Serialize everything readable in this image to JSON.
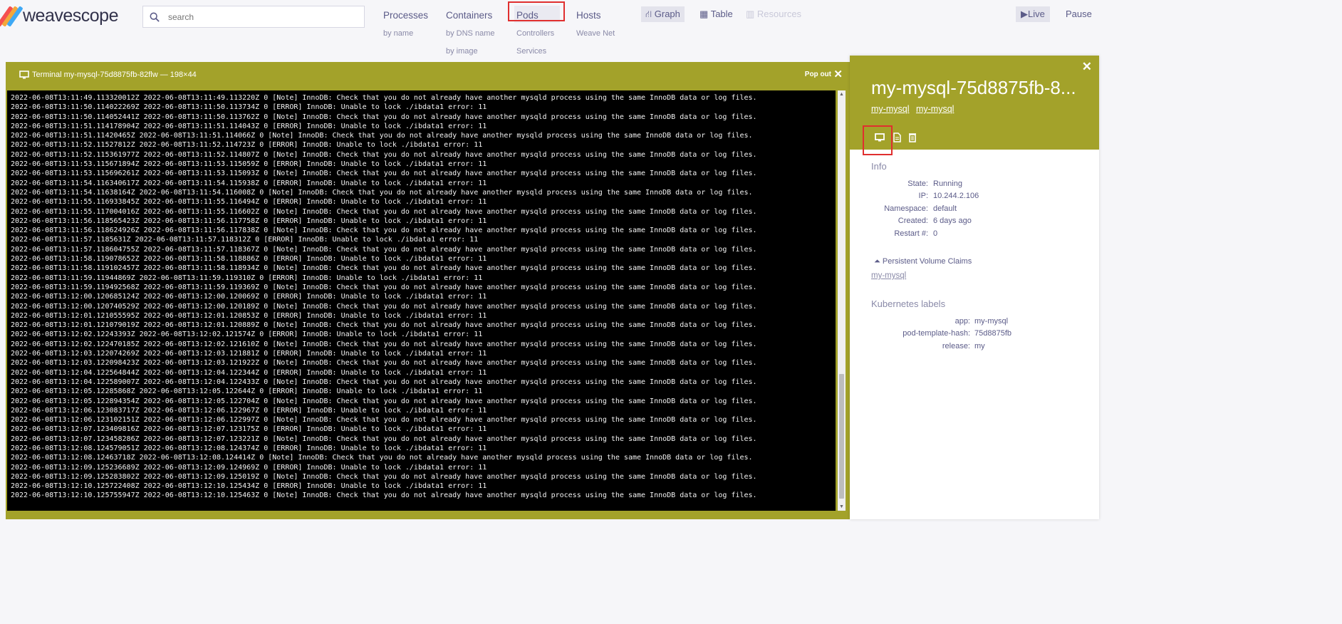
{
  "brand": {
    "weave": "weave",
    "scope": "scope",
    "colors": [
      "#f54f4f",
      "#f3a73b",
      "#7ab8e9",
      "#3fa9f5"
    ]
  },
  "search": {
    "placeholder": "search",
    "value": ""
  },
  "topologies": [
    {
      "label": "Processes",
      "subs": [
        "by name"
      ]
    },
    {
      "label": "Containers",
      "subs": [
        "by DNS name",
        "by image"
      ]
    },
    {
      "label": "Pods",
      "subs": [
        "Controllers",
        "Services"
      ]
    },
    {
      "label": "Hosts",
      "subs": [
        "Weave Net"
      ]
    }
  ],
  "views": {
    "graph": "Graph",
    "table": "Table",
    "resources": "Resources"
  },
  "controls": {
    "live": "Live",
    "pause": "Pause"
  },
  "terminal": {
    "title": "Terminal my-mysql-75d8875fb-82flw — 198×44",
    "popout": "Pop out",
    "close": "✕",
    "lines": [
      "2022-06-08T13:11:49.113320012Z 2022-06-08T13:11:49.113220Z 0 [Note] InnoDB: Check that you do not already have another mysqld process using the same InnoDB data or log files.",
      "2022-06-08T13:11:50.114022269Z 2022-06-08T13:11:50.113734Z 0 [ERROR] InnoDB: Unable to lock ./ibdata1 error: 11",
      "2022-06-08T13:11:50.114052441Z 2022-06-08T13:11:50.113762Z 0 [Note] InnoDB: Check that you do not already have another mysqld process using the same InnoDB data or log files.",
      "2022-06-08T13:11:51.114178904Z 2022-06-08T13:11:51.114043Z 0 [ERROR] InnoDB: Unable to lock ./ibdata1 error: 11",
      "2022-06-08T13:11:51.11420465Z 2022-06-08T13:11:51.114066Z 0 [Note] InnoDB: Check that you do not already have another mysqld process using the same InnoDB data or log files.",
      "2022-06-08T13:11:52.11527812Z 2022-06-08T13:11:52.114723Z 0 [ERROR] InnoDB: Unable to lock ./ibdata1 error: 11",
      "2022-06-08T13:11:52.115361977Z 2022-06-08T13:11:52.114807Z 0 [Note] InnoDB: Check that you do not already have another mysqld process using the same InnoDB data or log files.",
      "2022-06-08T13:11:53.115671894Z 2022-06-08T13:11:53.115059Z 0 [ERROR] InnoDB: Unable to lock ./ibdata1 error: 11",
      "2022-06-08T13:11:53.115696261Z 2022-06-08T13:11:53.115093Z 0 [Note] InnoDB: Check that you do not already have another mysqld process using the same InnoDB data or log files.",
      "2022-06-08T13:11:54.116340617Z 2022-06-08T13:11:54.115938Z 0 [ERROR] InnoDB: Unable to lock ./ibdata1 error: 11",
      "2022-06-08T13:11:54.11638164Z 2022-06-08T13:11:54.116008Z 0 [Note] InnoDB: Check that you do not already have another mysqld process using the same InnoDB data or log files.",
      "2022-06-08T13:11:55.116933845Z 2022-06-08T13:11:55.116494Z 0 [ERROR] InnoDB: Unable to lock ./ibdata1 error: 11",
      "2022-06-08T13:11:55.117004016Z 2022-06-08T13:11:55.116602Z 0 [Note] InnoDB: Check that you do not already have another mysqld process using the same InnoDB data or log files.",
      "2022-06-08T13:11:56.118565423Z 2022-06-08T13:11:56.117758Z 0 [ERROR] InnoDB: Unable to lock ./ibdata1 error: 11",
      "2022-06-08T13:11:56.118624926Z 2022-06-08T13:11:56.117838Z 0 [Note] InnoDB: Check that you do not already have another mysqld process using the same InnoDB data or log files.",
      "2022-06-08T13:11:57.1185631Z 2022-06-08T13:11:57.118312Z 0 [ERROR] InnoDB: Unable to lock ./ibdata1 error: 11",
      "2022-06-08T13:11:57.118604755Z 2022-06-08T13:11:57.118367Z 0 [Note] InnoDB: Check that you do not already have another mysqld process using the same InnoDB data or log files.",
      "2022-06-08T13:11:58.119078652Z 2022-06-08T13:11:58.118886Z 0 [ERROR] InnoDB: Unable to lock ./ibdata1 error: 11",
      "2022-06-08T13:11:58.119102457Z 2022-06-08T13:11:58.118934Z 0 [Note] InnoDB: Check that you do not already have another mysqld process using the same InnoDB data or log files.",
      "2022-06-08T13:11:59.11944869Z 2022-06-08T13:11:59.119310Z 0 [ERROR] InnoDB: Unable to lock ./ibdata1 error: 11",
      "2022-06-08T13:11:59.119492568Z 2022-06-08T13:11:59.119369Z 0 [Note] InnoDB: Check that you do not already have another mysqld process using the same InnoDB data or log files.",
      "2022-06-08T13:12:00.120685124Z 2022-06-08T13:12:00.120069Z 0 [ERROR] InnoDB: Unable to lock ./ibdata1 error: 11",
      "2022-06-08T13:12:00.120740529Z 2022-06-08T13:12:00.120189Z 0 [Note] InnoDB: Check that you do not already have another mysqld process using the same InnoDB data or log files.",
      "2022-06-08T13:12:01.121055595Z 2022-06-08T13:12:01.120853Z 0 [ERROR] InnoDB: Unable to lock ./ibdata1 error: 11",
      "2022-06-08T13:12:01.121079019Z 2022-06-08T13:12:01.120889Z 0 [Note] InnoDB: Check that you do not already have another mysqld process using the same InnoDB data or log files.",
      "2022-06-08T13:12:02.12243393Z 2022-06-08T13:12:02.121574Z 0 [ERROR] InnoDB: Unable to lock ./ibdata1 error: 11",
      "2022-06-08T13:12:02.122470185Z 2022-06-08T13:12:02.121610Z 0 [Note] InnoDB: Check that you do not already have another mysqld process using the same InnoDB data or log files.",
      "2022-06-08T13:12:03.122074269Z 2022-06-08T13:12:03.121881Z 0 [ERROR] InnoDB: Unable to lock ./ibdata1 error: 11",
      "2022-06-08T13:12:03.122098423Z 2022-06-08T13:12:03.121922Z 0 [Note] InnoDB: Check that you do not already have another mysqld process using the same InnoDB data or log files.",
      "2022-06-08T13:12:04.122564844Z 2022-06-08T13:12:04.122344Z 0 [ERROR] InnoDB: Unable to lock ./ibdata1 error: 11",
      "2022-06-08T13:12:04.122589007Z 2022-06-08T13:12:04.122433Z 0 [Note] InnoDB: Check that you do not already have another mysqld process using the same InnoDB data or log files.",
      "2022-06-08T13:12:05.12285868Z 2022-06-08T13:12:05.122644Z 0 [ERROR] InnoDB: Unable to lock ./ibdata1 error: 11",
      "2022-06-08T13:12:05.122894354Z 2022-06-08T13:12:05.122704Z 0 [Note] InnoDB: Check that you do not already have another mysqld process using the same InnoDB data or log files.",
      "2022-06-08T13:12:06.123083717Z 2022-06-08T13:12:06.122967Z 0 [ERROR] InnoDB: Unable to lock ./ibdata1 error: 11",
      "2022-06-08T13:12:06.123102151Z 2022-06-08T13:12:06.122997Z 0 [Note] InnoDB: Check that you do not already have another mysqld process using the same InnoDB data or log files.",
      "2022-06-08T13:12:07.123409816Z 2022-06-08T13:12:07.123175Z 0 [ERROR] InnoDB: Unable to lock ./ibdata1 error: 11",
      "2022-06-08T13:12:07.123458286Z 2022-06-08T13:12:07.123221Z 0 [Note] InnoDB: Check that you do not already have another mysqld process using the same InnoDB data or log files.",
      "2022-06-08T13:12:08.124579051Z 2022-06-08T13:12:08.124374Z 0 [ERROR] InnoDB: Unable to lock ./ibdata1 error: 11",
      "2022-06-08T13:12:08.12463718Z 2022-06-08T13:12:08.124414Z 0 [Note] InnoDB: Check that you do not already have another mysqld process using the same InnoDB data or log files.",
      "2022-06-08T13:12:09.125236689Z 2022-06-08T13:12:09.124969Z 0 [ERROR] InnoDB: Unable to lock ./ibdata1 error: 11",
      "2022-06-08T13:12:09.125283802Z 2022-06-08T13:12:09.125019Z 0 [Note] InnoDB: Check that you do not already have another mysqld process using the same InnoDB data or log files.",
      "2022-06-08T13:12:10.125722408Z 2022-06-08T13:12:10.125434Z 0 [ERROR] InnoDB: Unable to lock ./ibdata1 error: 11",
      "2022-06-08T13:12:10.125755947Z 2022-06-08T13:12:10.125463Z 0 [Note] InnoDB: Check that you do not already have another mysqld process using the same InnoDB data or log files."
    ]
  },
  "details": {
    "close": "✕",
    "title": "my-mysql-75d8875fb-8...",
    "links": [
      "my-mysql",
      "my-mysql"
    ],
    "tools": [
      "monitor-icon",
      "file-icon",
      "trash-icon"
    ],
    "info_heading": "Info",
    "info": [
      {
        "key": "State:",
        "value": "Running"
      },
      {
        "key": "IP:",
        "value": "10.244.2.106"
      },
      {
        "key": "Namespace:",
        "value": "default"
      },
      {
        "key": "Created:",
        "value": "6 days ago"
      },
      {
        "key": "Restart #:",
        "value": "0"
      }
    ],
    "pvc_heading": "Persistent Volume Claims",
    "pvc_link": "my-mysql",
    "labels_heading": "Kubernetes labels",
    "labels": [
      {
        "key": "app:",
        "value": "my-mysql"
      },
      {
        "key": "pod-template-hash:",
        "value": "75d8875fb"
      },
      {
        "key": "release:",
        "value": "my"
      }
    ]
  },
  "accent": "#a3a22a",
  "highlight": "#e02f2f"
}
